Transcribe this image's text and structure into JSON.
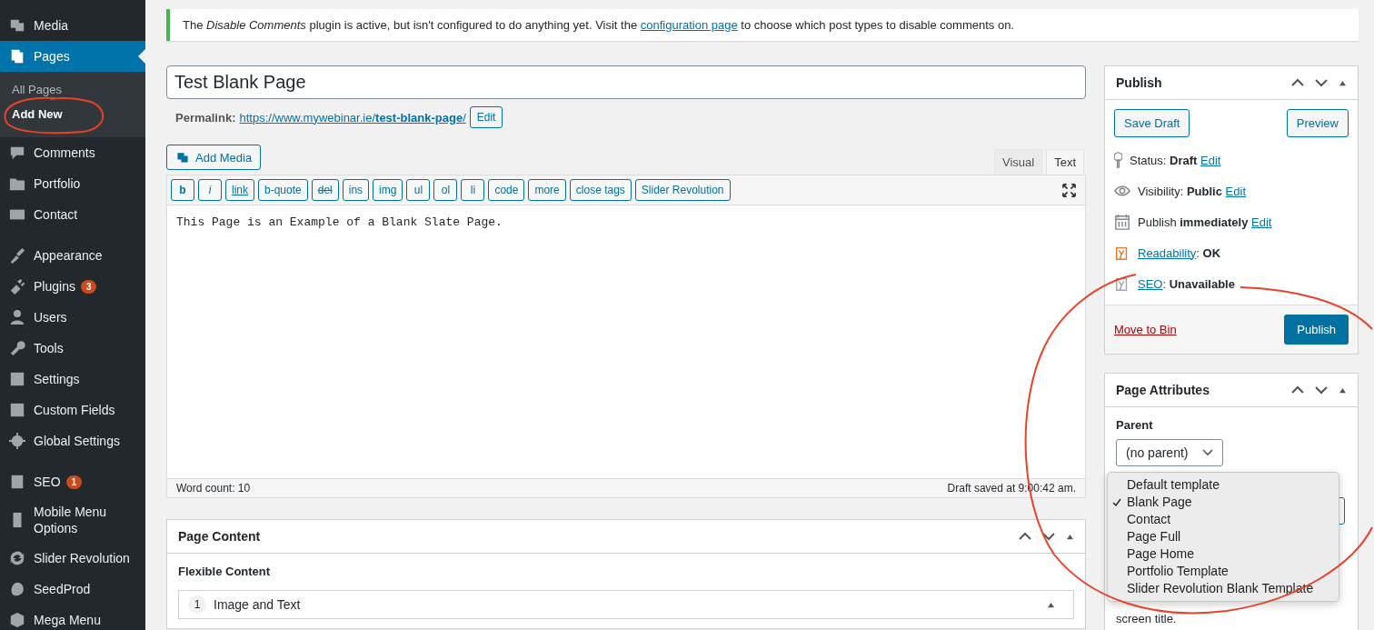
{
  "sidebar": {
    "groups": [
      [
        {
          "label": "Media",
          "selected": false
        },
        {
          "label": "Pages",
          "selected": true,
          "children": [
            {
              "label": "All Pages",
              "selected": false
            },
            {
              "label": "Add New",
              "selected": true
            }
          ]
        },
        {
          "label": "Comments",
          "selected": false
        },
        {
          "label": "Portfolio",
          "selected": false
        },
        {
          "label": "Contact",
          "selected": false
        }
      ],
      [
        {
          "label": "Appearance",
          "selected": false
        },
        {
          "label": "Plugins",
          "selected": false,
          "badge": "3"
        },
        {
          "label": "Users",
          "selected": false
        },
        {
          "label": "Tools",
          "selected": false
        },
        {
          "label": "Settings",
          "selected": false
        },
        {
          "label": "Custom Fields",
          "selected": false
        },
        {
          "label": "Global Settings",
          "selected": false
        }
      ],
      [
        {
          "label": "SEO",
          "selected": false,
          "badge": "1"
        },
        {
          "label": "Mobile Menu Options",
          "selected": false
        },
        {
          "label": "Slider Revolution",
          "selected": false
        },
        {
          "label": "SeedProd",
          "selected": false
        },
        {
          "label": "Mega Menu",
          "selected": false
        }
      ]
    ]
  },
  "notice": {
    "text": "The *Disable Comments* plugin is active, but isn't configured to do anything yet. Visit the",
    "link": "configuration page",
    "after": "to choose which post types to disable comments on."
  },
  "title_field": {
    "value": "Test Blank Page"
  },
  "permalink": {
    "label": "Permalink:",
    "url": "https://www.mywebinar.ie/**test-blank-page**/",
    "edit": "Edit"
  },
  "add_media": "Add Media",
  "editor_tabs": [
    {
      "label": "Visual",
      "selected": false
    },
    {
      "label": "Text",
      "selected": true
    }
  ],
  "quicktags": [
    "b",
    "i",
    "link",
    "b-quote",
    "del",
    "ins",
    "img",
    "ul",
    "ol",
    "li",
    "code",
    "more",
    "close tags",
    "Slider Revolution"
  ],
  "editor_text": "This Page is an Example of a Blank Slate Page.",
  "word_count": "Word count: 10",
  "draft_saved": "Draft saved at 9:00:42 am.",
  "page_content": {
    "title": "Page Content",
    "field_label": "Flexible Content",
    "rows": [
      {
        "number": "1",
        "label": "Image and Text"
      }
    ]
  },
  "publish": {
    "title": "Publish",
    "save_draft": "Save Draft",
    "preview": "Preview",
    "rows": [
      {
        "label": "Status:",
        "value": "Draft",
        "link": "Edit"
      },
      {
        "label": "Visibility:",
        "value": "Public",
        "link": "Edit"
      },
      {
        "label": "Publish",
        "value": "immediately",
        "link": "Edit"
      }
    ],
    "seo_rows": [
      {
        "link": "Readability",
        "separator": ":",
        "value": "OK",
        "color": "#f0752b"
      },
      {
        "link": "SEO",
        "separator": ":",
        "value": "Unavailable",
        "color": "#a0a5aa"
      }
    ],
    "move_to_bin": "Move to Bin",
    "publish_button": "Publish"
  },
  "page_attributes": {
    "title": "Page Attributes",
    "parent_label": "Parent",
    "parent_value": "(no parent)",
    "help_text": "screen title.",
    "template_options": [
      {
        "label": "Default template",
        "selected": false
      },
      {
        "label": "Blank Page",
        "selected": true
      },
      {
        "label": "Contact",
        "selected": false
      },
      {
        "label": "Page Full",
        "selected": false
      },
      {
        "label": "Page Home",
        "selected": false
      },
      {
        "label": "Portfolio Template",
        "selected": false
      },
      {
        "label": "Slider Revolution Blank Template",
        "selected": false
      }
    ]
  }
}
